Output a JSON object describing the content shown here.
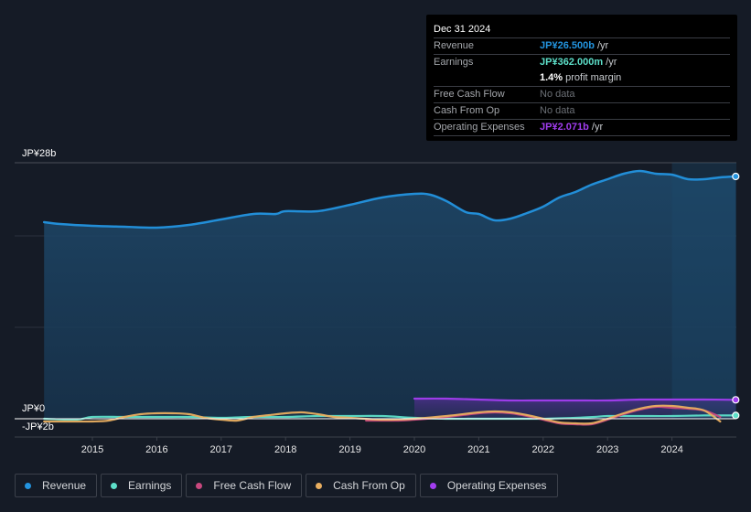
{
  "tooltip": {
    "date": "Dec 31 2024",
    "rows": [
      {
        "label": "Revenue",
        "value": "JP¥26.500b",
        "unit": " /yr",
        "color": "#2394df"
      },
      {
        "label": "Earnings",
        "value": "JP¥362.000m",
        "unit": " /yr",
        "color": "#5ddfc9"
      },
      {
        "label": "",
        "value": "1.4%",
        "unit": " profit margin",
        "color": "#ffffff"
      },
      {
        "label": "Free Cash Flow",
        "value": "No data",
        "unit": "",
        "color": "#6b6f75"
      },
      {
        "label": "Cash From Op",
        "value": "No data",
        "unit": "",
        "color": "#6b6f75"
      },
      {
        "label": "Operating Expenses",
        "value": "JP¥2.071b",
        "unit": " /yr",
        "color": "#a23df0"
      }
    ]
  },
  "legend": [
    {
      "label": "Revenue",
      "color": "#2394df"
    },
    {
      "label": "Earnings",
      "color": "#5ddfc9"
    },
    {
      "label": "Free Cash Flow",
      "color": "#c8487e"
    },
    {
      "label": "Cash From Op",
      "color": "#e8ae60"
    },
    {
      "label": "Operating Expenses",
      "color": "#a23df0"
    }
  ],
  "chart_data": {
    "type": "area",
    "title": "",
    "xlabel": "",
    "ylabel": "",
    "y_tick_labels": [
      "JP¥28b",
      "JP¥0",
      "-JP¥2b"
    ],
    "x_tick_labels": [
      "2015",
      "2016",
      "2017",
      "2018",
      "2019",
      "2020",
      "2021",
      "2022",
      "2023",
      "2024"
    ],
    "x_ticks": [
      2015,
      2016,
      2017,
      2018,
      2019,
      2020,
      2021,
      2022,
      2023,
      2024
    ],
    "xlim": [
      2013.5,
      2025.0
    ],
    "ylim": [
      -2,
      28
    ],
    "gridlines_y": [
      28,
      20,
      10,
      0
    ],
    "grid": true,
    "legend_position": "bottom-left",
    "highlight_region_start": 2024.0,
    "series": [
      {
        "name": "Revenue",
        "color": "#2394df",
        "fill": true,
        "end_marker": true,
        "x": [
          2014.25,
          2014.5,
          2015.0,
          2015.5,
          2016.0,
          2016.5,
          2017.0,
          2017.5,
          2017.85,
          2018.0,
          2018.5,
          2019.0,
          2019.5,
          2020.0,
          2020.25,
          2020.5,
          2020.8,
          2021.0,
          2021.25,
          2021.5,
          2021.75,
          2022.0,
          2022.25,
          2022.5,
          2022.75,
          2023.0,
          2023.25,
          2023.5,
          2023.75,
          2024.0,
          2024.25,
          2024.5,
          2024.75,
          2024.99
        ],
        "values": [
          21.5,
          21.3,
          21.1,
          21.0,
          20.9,
          21.2,
          21.8,
          22.4,
          22.4,
          22.7,
          22.7,
          23.4,
          24.2,
          24.6,
          24.5,
          23.8,
          22.6,
          22.4,
          21.7,
          21.9,
          22.5,
          23.2,
          24.2,
          24.8,
          25.6,
          26.2,
          26.8,
          27.1,
          26.8,
          26.7,
          26.2,
          26.2,
          26.4,
          26.5
        ]
      },
      {
        "name": "Earnings",
        "color": "#5ddfc9",
        "fill": false,
        "end_marker": true,
        "x": [
          2014.25,
          2014.75,
          2015.0,
          2015.5,
          2016.0,
          2016.5,
          2017.0,
          2017.5,
          2018.0,
          2018.5,
          2019.0,
          2019.5,
          2020.0,
          2020.5,
          2021.0,
          2021.5,
          2022.0,
          2022.5,
          2022.8,
          2023.0,
          2023.5,
          2024.0,
          2024.5,
          2024.99
        ],
        "values": [
          0.0,
          -0.1,
          0.2,
          0.2,
          0.2,
          0.2,
          0.1,
          0.2,
          0.2,
          0.3,
          0.3,
          0.3,
          0.1,
          0.0,
          0.0,
          0.0,
          0.0,
          0.1,
          0.2,
          0.3,
          0.3,
          0.3,
          0.36,
          0.36
        ]
      },
      {
        "name": "Free Cash Flow",
        "color": "#c8487e",
        "fill": false,
        "end_marker": false,
        "x": [
          2019.25,
          2019.75,
          2020.0,
          2020.5,
          2021.0,
          2021.25,
          2021.5,
          2021.75,
          2022.0,
          2022.25,
          2022.5,
          2022.75,
          2023.0,
          2023.25,
          2023.5,
          2023.75,
          2024.0,
          2024.25,
          2024.5,
          2024.75
        ],
        "values": [
          -0.2,
          -0.2,
          -0.1,
          0.2,
          0.6,
          0.7,
          0.6,
          0.3,
          -0.1,
          -0.5,
          -0.6,
          -0.6,
          -0.1,
          0.5,
          1.0,
          1.3,
          1.2,
          1.1,
          0.9,
          0.2
        ]
      },
      {
        "name": "Cash From Op",
        "color": "#e8ae60",
        "fill": false,
        "end_marker": false,
        "x": [
          2014.25,
          2014.75,
          2015.0,
          2015.25,
          2015.5,
          2015.75,
          2016.0,
          2016.25,
          2016.5,
          2016.75,
          2017.0,
          2017.25,
          2017.5,
          2017.75,
          2018.0,
          2018.25,
          2018.5,
          2018.75,
          2019.0,
          2019.5,
          2020.0,
          2020.5,
          2021.0,
          2021.25,
          2021.5,
          2021.75,
          2022.0,
          2022.25,
          2022.5,
          2022.75,
          2023.0,
          2023.25,
          2023.5,
          2023.75,
          2024.0,
          2024.25,
          2024.5,
          2024.75
        ],
        "values": [
          -0.3,
          -0.3,
          -0.3,
          -0.2,
          0.2,
          0.5,
          0.6,
          0.6,
          0.5,
          0.1,
          -0.1,
          -0.2,
          0.2,
          0.4,
          0.6,
          0.7,
          0.5,
          0.2,
          0.1,
          -0.1,
          0.0,
          0.3,
          0.7,
          0.8,
          0.7,
          0.4,
          0.0,
          -0.4,
          -0.5,
          -0.5,
          0.0,
          0.6,
          1.1,
          1.4,
          1.4,
          1.2,
          0.9,
          -0.3
        ]
      },
      {
        "name": "Operating Expenses",
        "color": "#a23df0",
        "fill": true,
        "end_marker": true,
        "x": [
          2020.0,
          2020.5,
          2021.0,
          2021.5,
          2022.0,
          2022.5,
          2023.0,
          2023.5,
          2024.0,
          2024.5,
          2024.99
        ],
        "values": [
          2.2,
          2.2,
          2.1,
          2.0,
          2.0,
          2.0,
          2.0,
          2.1,
          2.1,
          2.1,
          2.07
        ]
      }
    ]
  }
}
